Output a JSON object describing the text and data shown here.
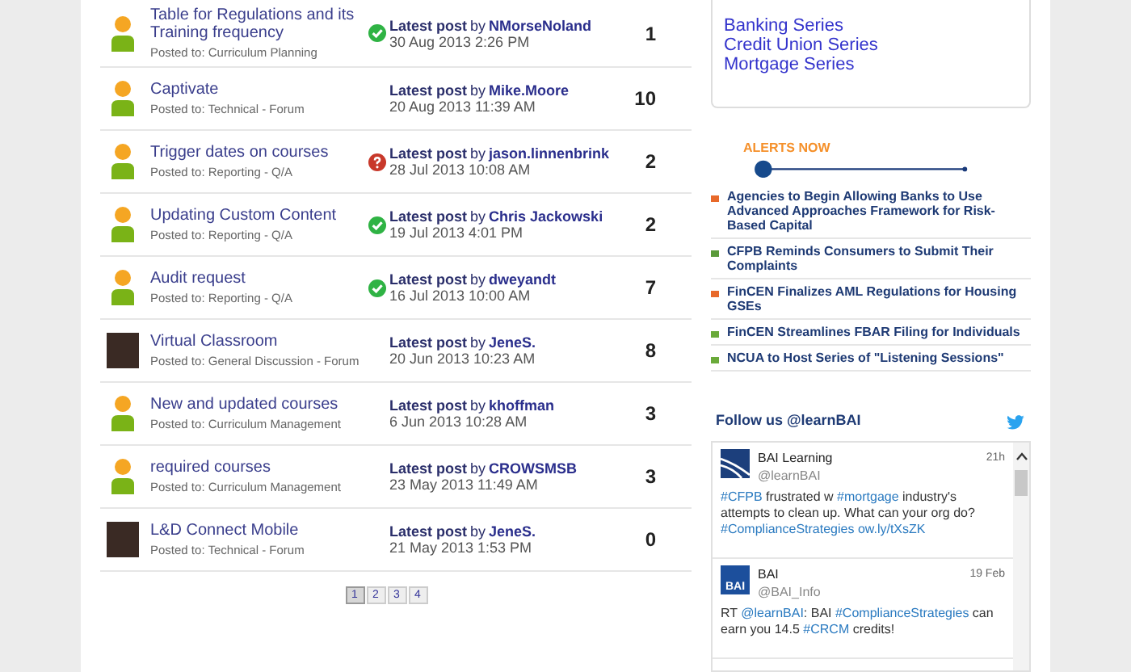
{
  "topics": [
    {
      "title": "Table for Regulations and its Training frequency",
      "posted_to": "Posted to: Curriculum Planning",
      "avatar": {
        "kind": "default"
      },
      "status": {
        "kind": "answered"
      },
      "latest_label": "Latest post",
      "by": "by",
      "author": "NMorseNoland",
      "date": "30 Aug 2013 2:26 PM",
      "count": "1"
    },
    {
      "title": "Captivate",
      "posted_to": "Posted to: Technical - Forum",
      "avatar": {
        "kind": "default"
      },
      "latest_label": "Latest post",
      "by": "by",
      "author": "Mike.Moore",
      "date": "20 Aug 2013 11:39 AM",
      "count": "10"
    },
    {
      "title": "Trigger dates on courses",
      "posted_to": "Posted to: Reporting - Q/A",
      "avatar": {
        "kind": "default"
      },
      "status": {
        "kind": "question"
      },
      "latest_label": "Latest post",
      "by": "by",
      "author": "jason.linnenbrink",
      "date": "28 Jul 2013 10:08 AM",
      "count": "2"
    },
    {
      "title": "Updating Custom Content",
      "posted_to": "Posted to: Reporting - Q/A",
      "avatar": {
        "kind": "default"
      },
      "status": {
        "kind": "answered"
      },
      "latest_label": "Latest post",
      "by": "by",
      "author": "Chris Jackowski",
      "date": "19 Jul 2013 4:01 PM",
      "count": "2"
    },
    {
      "title": "Audit request",
      "posted_to": "Posted to: Reporting - Q/A",
      "avatar": {
        "kind": "default"
      },
      "status": {
        "kind": "answered"
      },
      "latest_label": "Latest post",
      "by": "by",
      "author": "dweyandt",
      "date": "16 Jul 2013 10:00 AM",
      "count": "7"
    },
    {
      "title": "Virtual Classroom",
      "posted_to": "Posted to: General Discussion - Forum",
      "avatar": {
        "kind": "photo"
      },
      "latest_label": "Latest post",
      "by": "by",
      "author": "JeneS.",
      "date": "20 Jun 2013 10:23 AM",
      "count": "8"
    },
    {
      "title": "New and updated courses",
      "posted_to": "Posted to: Curriculum Management",
      "avatar": {
        "kind": "default"
      },
      "latest_label": "Latest post",
      "by": "by",
      "author": "khoffman",
      "date": "6 Jun 2013 10:28 AM",
      "count": "3"
    },
    {
      "title": "required courses",
      "posted_to": "Posted to: Curriculum Management",
      "avatar": {
        "kind": "default"
      },
      "latest_label": "Latest post",
      "by": "by",
      "author": "CROWSMSB",
      "date": "23 May 2013 11:49 AM",
      "count": "3"
    },
    {
      "title": "L&D Connect Mobile",
      "posted_to": "Posted to: Technical - Forum",
      "avatar": {
        "kind": "photo"
      },
      "latest_label": "Latest post",
      "by": "by",
      "author": "JeneS.",
      "date": "21 May 2013 1:53 PM",
      "count": "0"
    }
  ],
  "pagination": [
    {
      "label": "1",
      "selected": true
    },
    {
      "label": "2",
      "selected": false
    },
    {
      "label": "3",
      "selected": false
    },
    {
      "label": "4",
      "selected": false
    }
  ],
  "series_links": [
    "Banking Series",
    "Credit Union Series",
    "Mortgage Series"
  ],
  "alerts": {
    "title": "ALERTS NOW",
    "items": [
      {
        "text": "Agencies to Begin Allowing Banks to Use Advanced Approaches Framework for Risk-Based Capital",
        "color": "#e8692a"
      },
      {
        "text": "CFPB Reminds Consumers to Submit Their Complaints",
        "color": "#5a9a3a"
      },
      {
        "text": "FinCEN Finalizes AML Regulations for Housing GSEs",
        "color": "#e8692a"
      },
      {
        "text": "FinCEN Streamlines FBAR Filing for Individuals",
        "color": "#6aaa3a"
      },
      {
        "text": "NCUA to Host Series of \"Listening Sessions\"",
        "color": "#6aaa3a"
      }
    ]
  },
  "twitter": {
    "title": "Follow us @learnBAI",
    "tweets": [
      {
        "name": "BAI Learning",
        "handle": "@learnBAI",
        "time": "21h",
        "logo": {
          "kind": "swoosh"
        },
        "text": [
          {
            "kind": "link",
            "text": "#CFPB"
          },
          {
            "kind": "plain",
            "text": " frustrated w "
          },
          {
            "kind": "link",
            "text": "#mortgage"
          },
          {
            "kind": "plain",
            "text": " industry's attempts to clean up. What can your org do? "
          },
          {
            "kind": "link",
            "text": "#ComplianceStrategies"
          },
          {
            "kind": "space"
          },
          {
            "kind": "link",
            "text": "ow.ly/tXsZK"
          }
        ]
      },
      {
        "name": "BAI",
        "handle": "@BAI_Info",
        "time": "19 Feb",
        "logo": {
          "kind": "badge",
          "text": "BAI"
        },
        "text": [
          {
            "kind": "plain",
            "text": "RT "
          },
          {
            "kind": "link",
            "text": "@learnBAI"
          },
          {
            "kind": "plain",
            "text": ": BAI "
          },
          {
            "kind": "link",
            "text": "#ComplianceStrategies"
          },
          {
            "kind": "plain",
            "text": " can earn you 14.5 "
          },
          {
            "kind": "link",
            "text": "#CRCM"
          },
          {
            "kind": "plain",
            "text": " credits!"
          }
        ]
      }
    ]
  }
}
